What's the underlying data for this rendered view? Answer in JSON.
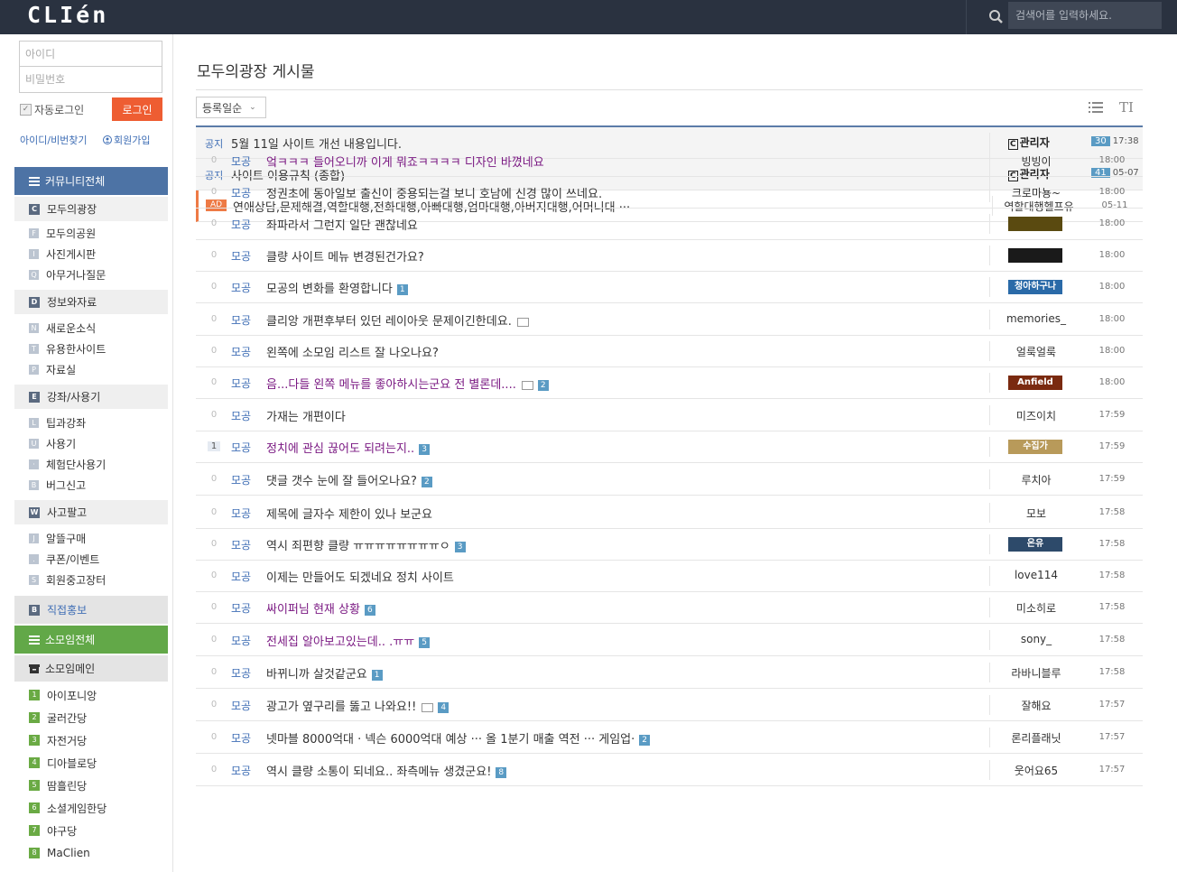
{
  "header": {
    "logo": "CLIén",
    "search_placeholder": "검색어를 입력하세요."
  },
  "login": {
    "id_placeholder": "아이디",
    "pw_placeholder": "비밀번호",
    "auto_login": "자동로그인",
    "login_btn": "로그인",
    "find": "아이디/비번찾기",
    "join": "회원가입"
  },
  "sidebar": {
    "community_all": "커뮤니티전체",
    "sections": [
      {
        "icon": "C",
        "label": "모두의광장",
        "items": [
          {
            "icon": "F",
            "label": "모두의공원"
          },
          {
            "icon": "I",
            "label": "사진게시판"
          },
          {
            "icon": "Q",
            "label": "아무거나질문"
          }
        ]
      },
      {
        "icon": "D",
        "label": "정보와자료",
        "items": [
          {
            "icon": "N",
            "label": "새로운소식"
          },
          {
            "icon": "T",
            "label": "유용한사이트"
          },
          {
            "icon": "P",
            "label": "자료실"
          }
        ]
      },
      {
        "icon": "E",
        "label": "강좌/사용기",
        "items": [
          {
            "icon": "L",
            "label": "팁과강좌"
          },
          {
            "icon": "U",
            "label": "사용기"
          },
          {
            "icon": "·",
            "label": "체험단사용기"
          },
          {
            "icon": "B",
            "label": "버그신고"
          }
        ]
      },
      {
        "icon": "W",
        "label": "사고팔고",
        "items": [
          {
            "icon": "J",
            "label": "알뜰구매"
          },
          {
            "icon": ".",
            "label": "쿠폰/이벤트"
          },
          {
            "icon": "S",
            "label": "회원중고장터"
          }
        ]
      }
    ],
    "promo": {
      "icon": "B",
      "label": "직접홍보"
    },
    "group_all": "소모임전체",
    "group_main": "소모임메인",
    "groups": [
      {
        "num": "1",
        "label": "아이포니앙"
      },
      {
        "num": "2",
        "label": "굴러간당"
      },
      {
        "num": "3",
        "label": "자전거당"
      },
      {
        "num": "4",
        "label": "디아블로당"
      },
      {
        "num": "5",
        "label": "땀흘린당"
      },
      {
        "num": "6",
        "label": "소셜게임한당"
      },
      {
        "num": "7",
        "label": "야구당"
      },
      {
        "num": "8",
        "label": "MaClien"
      }
    ]
  },
  "board": {
    "title": "모두의광장 게시물",
    "sort": "등록일순"
  },
  "notices": [
    {
      "label": "공지",
      "subject": "5월 11일 사이트 개선 내용입니다.",
      "author": "관리자",
      "hits": "30",
      "time": "17:38"
    },
    {
      "label": "공지",
      "subject": "사이트 이용규칙 (종합)",
      "author": "관리자",
      "hits": "41",
      "time": "05-07"
    }
  ],
  "ad": {
    "badge": "AD",
    "subject": "연애상담,문제해결,역할대행,전화대행,아빠대행,엄마대행,아버지대행,어머니대 ···",
    "author": "역할대행헬프유",
    "time": "05-11"
  },
  "posts": [
    {
      "count": "0",
      "cat": "모공",
      "subject": "엌ㅋㅋㅋ 들어오니까 이게 뭐죠ㅋㅋㅋㅋ 디자인 바꼈네요",
      "visited": true,
      "img": false,
      "comments": "",
      "author": "빙빙이",
      "time": "18:00"
    },
    {
      "count": "0",
      "cat": "모공",
      "subject": "정권초에 동아일보 출신이 중용되는걸 보니 호남에 신경 많이 쓰네요.",
      "visited": false,
      "img": false,
      "comments": "",
      "author": "크로마뇽~",
      "time": "18:00"
    },
    {
      "count": "0",
      "cat": "모공",
      "subject": "좌파라서 그런지 일단 괜찮네요",
      "visited": false,
      "img": false,
      "comments": "",
      "author": "",
      "nickimg": "#5a4a10",
      "time": "18:00"
    },
    {
      "count": "0",
      "cat": "모공",
      "subject": "클량 사이트 메뉴 변경된건가요?",
      "visited": false,
      "img": false,
      "comments": "",
      "author": "",
      "nickimg": "#1a1a1a",
      "time": "18:00"
    },
    {
      "count": "0",
      "cat": "모공",
      "subject": "모공의 변화를 환영합니다",
      "visited": false,
      "img": false,
      "comments": "1",
      "author": "",
      "nickimg": "#2a6aa8",
      "nicktext": "청아하구나",
      "time": "18:00"
    },
    {
      "count": "0",
      "cat": "모공",
      "subject": "클리앙 개편후부터 있던 레이아웃 문제이긴한데요.",
      "visited": false,
      "img": true,
      "comments": "",
      "author": "memories_",
      "time": "18:00"
    },
    {
      "count": "0",
      "cat": "모공",
      "subject": "왼쪽에 소모임 리스트 잘 나오나요?",
      "visited": false,
      "img": false,
      "comments": "",
      "author": "얼룩얼룩",
      "time": "18:00"
    },
    {
      "count": "0",
      "cat": "모공",
      "subject": "음...다들 왼쪽 메뉴를 좋아하시는군요 전 별론데....",
      "visited": true,
      "img": true,
      "comments": "2",
      "author": "",
      "nickimg": "#7a2a10",
      "nicktext": "Anfield",
      "time": "18:00"
    },
    {
      "count": "0",
      "cat": "모공",
      "subject": "가재는 개편이다",
      "visited": false,
      "img": false,
      "comments": "",
      "author": "미즈이치",
      "time": "17:59"
    },
    {
      "count": "1",
      "cat": "모공",
      "subject": "정치에 관심 끊어도 되려는지..",
      "visited": true,
      "img": false,
      "comments": "3",
      "author": "",
      "nickimg": "#b89a5a",
      "nicktext": "수집가",
      "time": "17:59"
    },
    {
      "count": "0",
      "cat": "모공",
      "subject": "댓글 갯수 눈에 잘 들어오나요?",
      "visited": false,
      "img": false,
      "comments": "2",
      "author": "루치아",
      "time": "17:59"
    },
    {
      "count": "0",
      "cat": "모공",
      "subject": "제목에 글자수 제한이 있나 보군요",
      "visited": false,
      "img": false,
      "comments": "",
      "author": "모보",
      "time": "17:58"
    },
    {
      "count": "0",
      "cat": "모공",
      "subject": "역시 죄편향 클량 ㅠㅠㅠㅠㅠㅠㅠㅠㅇ",
      "visited": false,
      "img": false,
      "comments": "3",
      "author": "",
      "nickimg": "#2d4a6a",
      "nicktext": "온유",
      "time": "17:58"
    },
    {
      "count": "0",
      "cat": "모공",
      "subject": "이제는 만들어도 되겠네요 정치 사이트",
      "visited": false,
      "img": false,
      "comments": "",
      "author": "love114",
      "time": "17:58"
    },
    {
      "count": "0",
      "cat": "모공",
      "subject": "싸이퍼님 현재 상황",
      "visited": true,
      "img": false,
      "comments": "6",
      "author": "미소히로",
      "time": "17:58"
    },
    {
      "count": "0",
      "cat": "모공",
      "subject": "전세집 알아보고있는데.. .ㅠㅠ",
      "visited": true,
      "img": false,
      "comments": "5",
      "author": "sony_",
      "time": "17:58"
    },
    {
      "count": "0",
      "cat": "모공",
      "subject": "바뀌니까 살것같군요",
      "visited": false,
      "img": false,
      "comments": "1",
      "author": "라바니블루",
      "time": "17:58"
    },
    {
      "count": "0",
      "cat": "모공",
      "subject": "광고가 옆구리를 뚫고 나와요!!",
      "visited": false,
      "img": true,
      "comments": "4",
      "author": "잘해요",
      "time": "17:57"
    },
    {
      "count": "0",
      "cat": "모공",
      "subject": "넷마블 8000억대 · 넥슨 6000억대 예상 ··· 올 1분기 매출 역전 ··· 게임업·",
      "visited": false,
      "img": false,
      "comments": "2",
      "author": "론리플래닛",
      "time": "17:57"
    },
    {
      "count": "0",
      "cat": "모공",
      "subject": "역시 클량 소통이 되네요.. 좌측메뉴 생겼군요!",
      "visited": false,
      "img": false,
      "comments": "8",
      "author": "웃어요65",
      "time": "17:57"
    }
  ]
}
